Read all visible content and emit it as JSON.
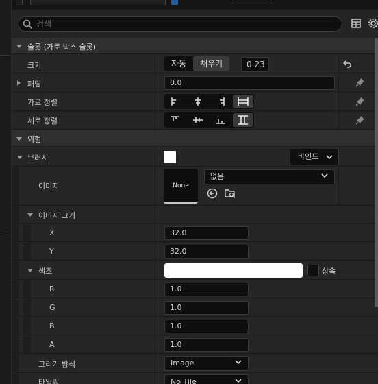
{
  "search": {
    "placeholder": "검색"
  },
  "toolbar": {
    "table_icon": "table-icon",
    "settings_icon": "gear-icon"
  },
  "sections": {
    "slot": {
      "title": "슬롯 (가로 박스 슬롯)"
    },
    "appearance": {
      "title": "외형"
    }
  },
  "props": {
    "size": {
      "label": "크기",
      "auto": "자동",
      "fill": "채우기",
      "value": "0.23"
    },
    "padding": {
      "label": "패딩",
      "value": "0.0"
    },
    "halign": {
      "label": "가로 정렬"
    },
    "valign": {
      "label": "세로 정렬"
    },
    "brush": {
      "label": "브러시",
      "bind_label": "바인드"
    },
    "image": {
      "label": "이미지",
      "thumb_text": "None",
      "asset_value": "없음"
    },
    "image_size": {
      "label": "이미지 크기",
      "x_label": "X",
      "x_value": "32.0",
      "y_label": "Y",
      "y_value": "32.0"
    },
    "tint": {
      "label": "색조",
      "inherit_label": "상속",
      "swatch_color": "#ffffff",
      "r_label": "R",
      "r_value": "1.0",
      "g_label": "G",
      "g_value": "1.0",
      "b_label": "B",
      "b_value": "1.0",
      "a_label": "A",
      "a_value": "1.0"
    },
    "draw_as": {
      "label": "그리기 방식",
      "value": "Image"
    },
    "tiling": {
      "label": "타일링",
      "value": "No Tile"
    }
  }
}
